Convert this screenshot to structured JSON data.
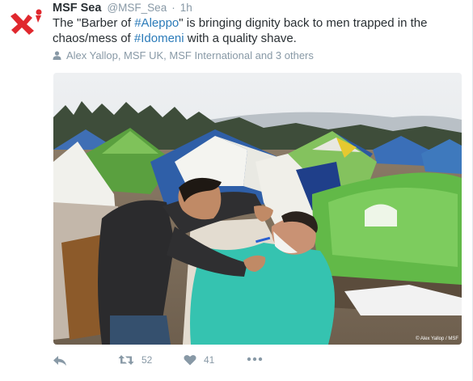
{
  "tweet": {
    "author_name": "MSF Sea",
    "handle": "@MSF_Sea",
    "separator": "·",
    "time": "1h",
    "text_prefix": "The \"Barber of ",
    "hashtag_1": "#Aleppo",
    "text_middle": "\" is bringing dignity back to men trapped in the chaos/mess of ",
    "hashtag_2": "#Idomeni",
    "text_suffix": " with a quality shave.",
    "tagged_users": "Alex Yallop, MSF UK, MSF International and 3 others",
    "photo_credit": "© Alex Yallop / MSF"
  },
  "actions": {
    "retweet_count": "52",
    "like_count": "41"
  },
  "colors": {
    "link": "#2b7bb9",
    "muted": "#8899a6",
    "text": "#292f33",
    "brand_red": "#e0282e"
  },
  "icons": [
    "msf-logo-icon",
    "person-icon",
    "reply-icon",
    "retweet-icon",
    "heart-icon",
    "more-icon"
  ]
}
